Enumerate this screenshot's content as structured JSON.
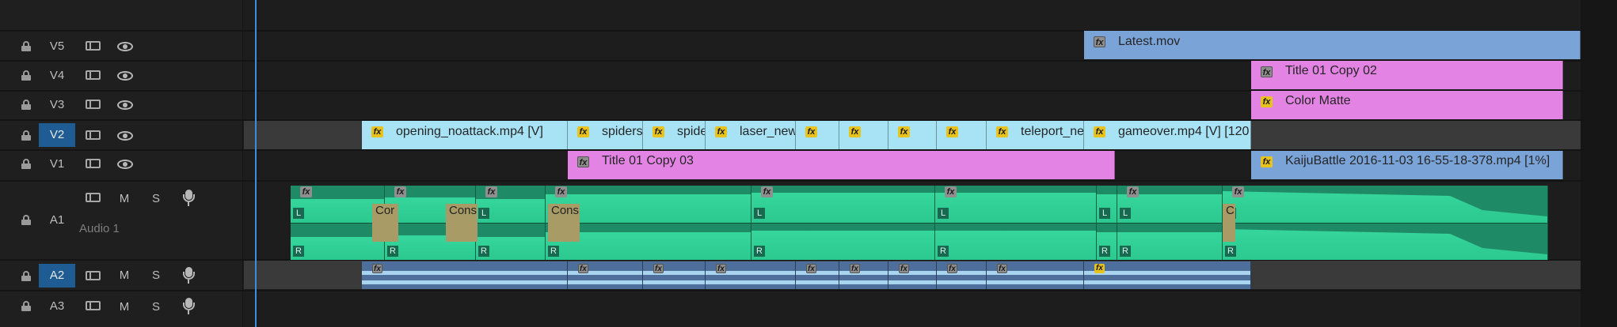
{
  "tracks": {
    "V5": {
      "label": "V5"
    },
    "V4": {
      "label": "V4"
    },
    "V3": {
      "label": "V3"
    },
    "V2": {
      "label": "V2"
    },
    "V1": {
      "label": "V1"
    },
    "A1": {
      "label": "A1",
      "name": "Audio 1",
      "mute": "M",
      "solo": "S"
    },
    "A2": {
      "label": "A2",
      "mute": "M",
      "solo": "S"
    },
    "A3": {
      "label": "A3",
      "mute": "M",
      "solo": "S"
    }
  },
  "clips": {
    "latest": "Latest.mov",
    "title_copy02": "Title 01 Copy 02",
    "color_matte": "Color Matte",
    "opening": "opening_noattack.mp4 [V]",
    "spiders1": "spiders",
    "spiders2": "spide",
    "laser": "laser_new",
    "teleport": "teleport_ne",
    "gameover": "gameover.mp4 [V] [120",
    "title_copy03": "Title 01 Copy 03",
    "kaiju": "KaijuBattle 2016-11-03 16-55-18-378.mp4 [1%]"
  },
  "audio": {
    "crossfade1": "Cor",
    "crossfade2": "Cons",
    "crossfade3": "Cons",
    "crossfade4": "C",
    "left": "L",
    "right": "R"
  },
  "fx_label": "fx",
  "colors": {
    "video_clip": "#a7e3f5",
    "title_clip": "#e383e3",
    "nested_clip": "#7aa3d8",
    "audio_clip": "#2ac48f",
    "audio_a2": "#4e6f9b",
    "track_selected": "#1f5c93",
    "playhead": "#3b8de0"
  }
}
